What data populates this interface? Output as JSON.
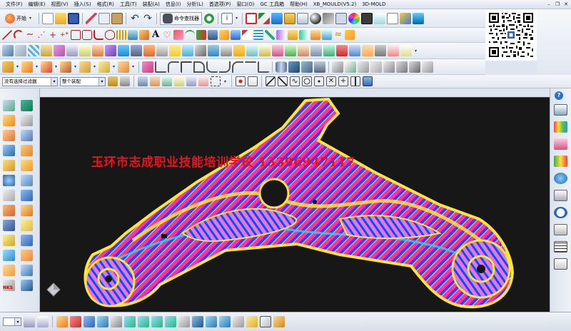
{
  "menu": [
    "文件(F)",
    "编辑(E)",
    "视图(V)",
    "插入(S)",
    "格式(R)",
    "工具(T)",
    "装配(A)",
    "信息(I)",
    "分析(L)",
    "首选项(P)",
    "窗口(O)",
    "GC 工具箱",
    "帮助(H)",
    "XB_MOULD(V5.2)",
    "3D-MOLD"
  ],
  "toolbar": {
    "start_label": "开始",
    "command_finder_label": "命令查找器"
  },
  "selection": {
    "filter_value": "没有选择过滤器",
    "scope_value": "整个装配"
  },
  "viewport": {
    "watermark": "玉环市志成职业技能培训学校 13396947117",
    "background": "#171717"
  },
  "left_dock": {
    "label": "NKS"
  },
  "right_dock": {
    "help_symbol": "?"
  },
  "colors": {
    "part_pink": "#ff2fa8",
    "part_blue": "#2f3fff",
    "part_yellow": "#ffe53a",
    "part_cyan": "#22d8ff",
    "watermark_red": "#e8131c"
  }
}
